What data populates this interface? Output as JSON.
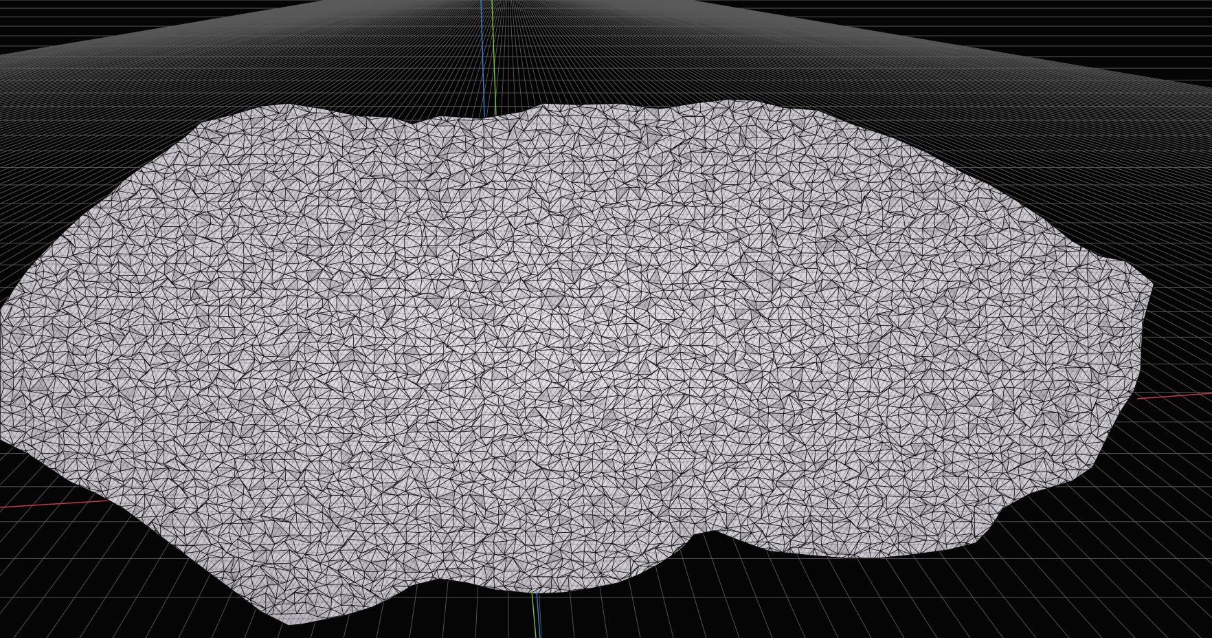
{
  "viewport": {
    "background_color": "#050505",
    "grid_color": "#5a5a5a",
    "mesh_fill_color": "#d6d2da",
    "mesh_wire_color": "#0a0a0a",
    "axis_x_color": "#c8394a",
    "axis_y_color": "#7ec43a",
    "axis_z_color": "#3a7fd6",
    "shading": "wireframe-on-shaded",
    "object_type": "mesh",
    "axes_visible": [
      "x",
      "y",
      "z"
    ],
    "grid_visible": true
  }
}
